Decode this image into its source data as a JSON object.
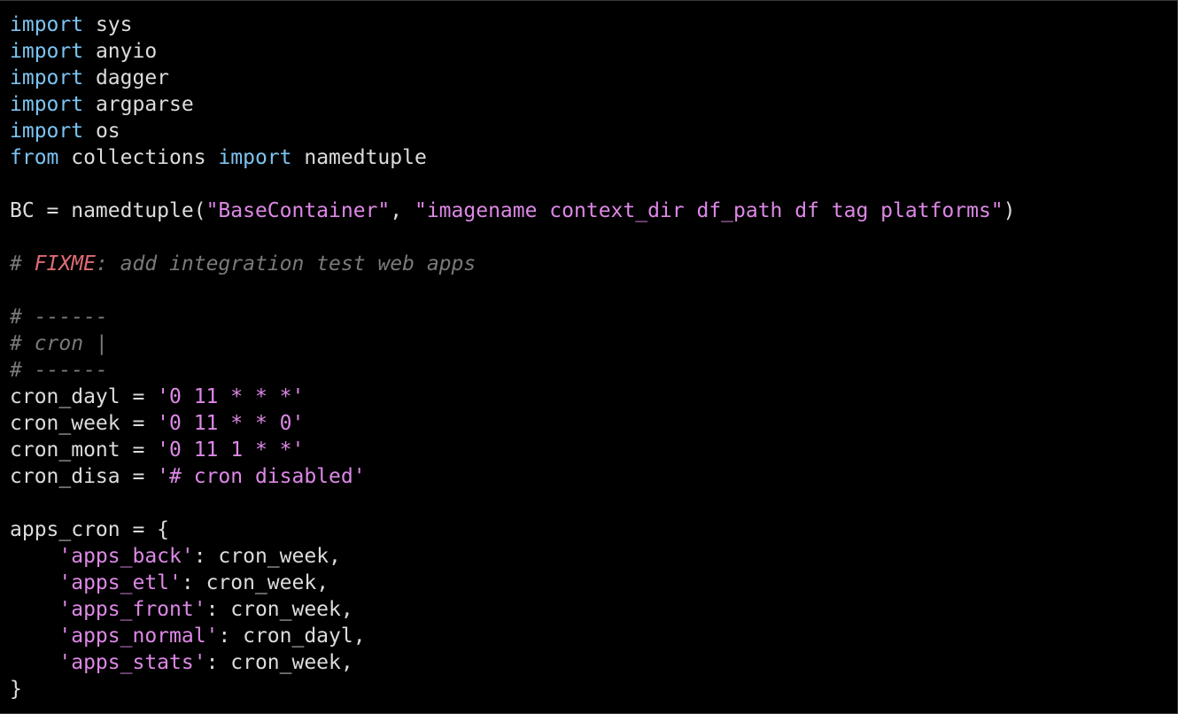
{
  "editor": {
    "language": "python",
    "colors": {
      "background": "#000000",
      "text": "#dcdcdc",
      "keyword": "#7cc4f2",
      "string": "#dd88e6",
      "comment": "#7a7a7a",
      "todo": "#e06c75"
    },
    "lines": [
      [
        {
          "t": "kw",
          "v": "import"
        },
        {
          "t": "plain",
          "v": " sys"
        }
      ],
      [
        {
          "t": "kw",
          "v": "import"
        },
        {
          "t": "plain",
          "v": " anyio"
        }
      ],
      [
        {
          "t": "kw",
          "v": "import"
        },
        {
          "t": "plain",
          "v": " dagger"
        }
      ],
      [
        {
          "t": "kw",
          "v": "import"
        },
        {
          "t": "plain",
          "v": " argparse"
        }
      ],
      [
        {
          "t": "kw",
          "v": "import"
        },
        {
          "t": "plain",
          "v": " os"
        }
      ],
      [
        {
          "t": "kw",
          "v": "from"
        },
        {
          "t": "plain",
          "v": " collections "
        },
        {
          "t": "kw",
          "v": "import"
        },
        {
          "t": "plain",
          "v": " namedtuple"
        }
      ],
      [],
      [
        {
          "t": "plain",
          "v": "BC = namedtuple("
        },
        {
          "t": "str",
          "v": "\"BaseContainer\""
        },
        {
          "t": "plain",
          "v": ", "
        },
        {
          "t": "str",
          "v": "\"imagename context_dir df_path df tag platforms\""
        },
        {
          "t": "plain",
          "v": ")"
        }
      ],
      [],
      [
        {
          "t": "cmt",
          "v": "# "
        },
        {
          "t": "todo",
          "v": "FIXME"
        },
        {
          "t": "cmt",
          "v": ": add integration test web apps"
        }
      ],
      [],
      [
        {
          "t": "cmt",
          "v": "# ------"
        }
      ],
      [
        {
          "t": "cmt",
          "v": "# cron |"
        }
      ],
      [
        {
          "t": "cmt",
          "v": "# ------"
        }
      ],
      [
        {
          "t": "plain",
          "v": "cron_dayl = "
        },
        {
          "t": "str",
          "v": "'0 11 * * *'"
        }
      ],
      [
        {
          "t": "plain",
          "v": "cron_week = "
        },
        {
          "t": "str",
          "v": "'0 11 * * 0'"
        }
      ],
      [
        {
          "t": "plain",
          "v": "cron_mont = "
        },
        {
          "t": "str",
          "v": "'0 11 1 * *'"
        }
      ],
      [
        {
          "t": "plain",
          "v": "cron_disa = "
        },
        {
          "t": "str",
          "v": "'# cron disabled'"
        }
      ],
      [],
      [
        {
          "t": "plain",
          "v": "apps_cron = {"
        }
      ],
      [
        {
          "t": "plain",
          "v": "    "
        },
        {
          "t": "str",
          "v": "'apps_back'"
        },
        {
          "t": "plain",
          "v": ": cron_week,"
        }
      ],
      [
        {
          "t": "plain",
          "v": "    "
        },
        {
          "t": "str",
          "v": "'apps_etl'"
        },
        {
          "t": "plain",
          "v": ": cron_week,"
        }
      ],
      [
        {
          "t": "plain",
          "v": "    "
        },
        {
          "t": "str",
          "v": "'apps_front'"
        },
        {
          "t": "plain",
          "v": ": cron_week,"
        }
      ],
      [
        {
          "t": "plain",
          "v": "    "
        },
        {
          "t": "str",
          "v": "'apps_normal'"
        },
        {
          "t": "plain",
          "v": ": cron_dayl,"
        }
      ],
      [
        {
          "t": "plain",
          "v": "    "
        },
        {
          "t": "str",
          "v": "'apps_stats'"
        },
        {
          "t": "plain",
          "v": ": cron_week,"
        }
      ],
      [
        {
          "t": "plain",
          "v": "}"
        }
      ]
    ]
  }
}
